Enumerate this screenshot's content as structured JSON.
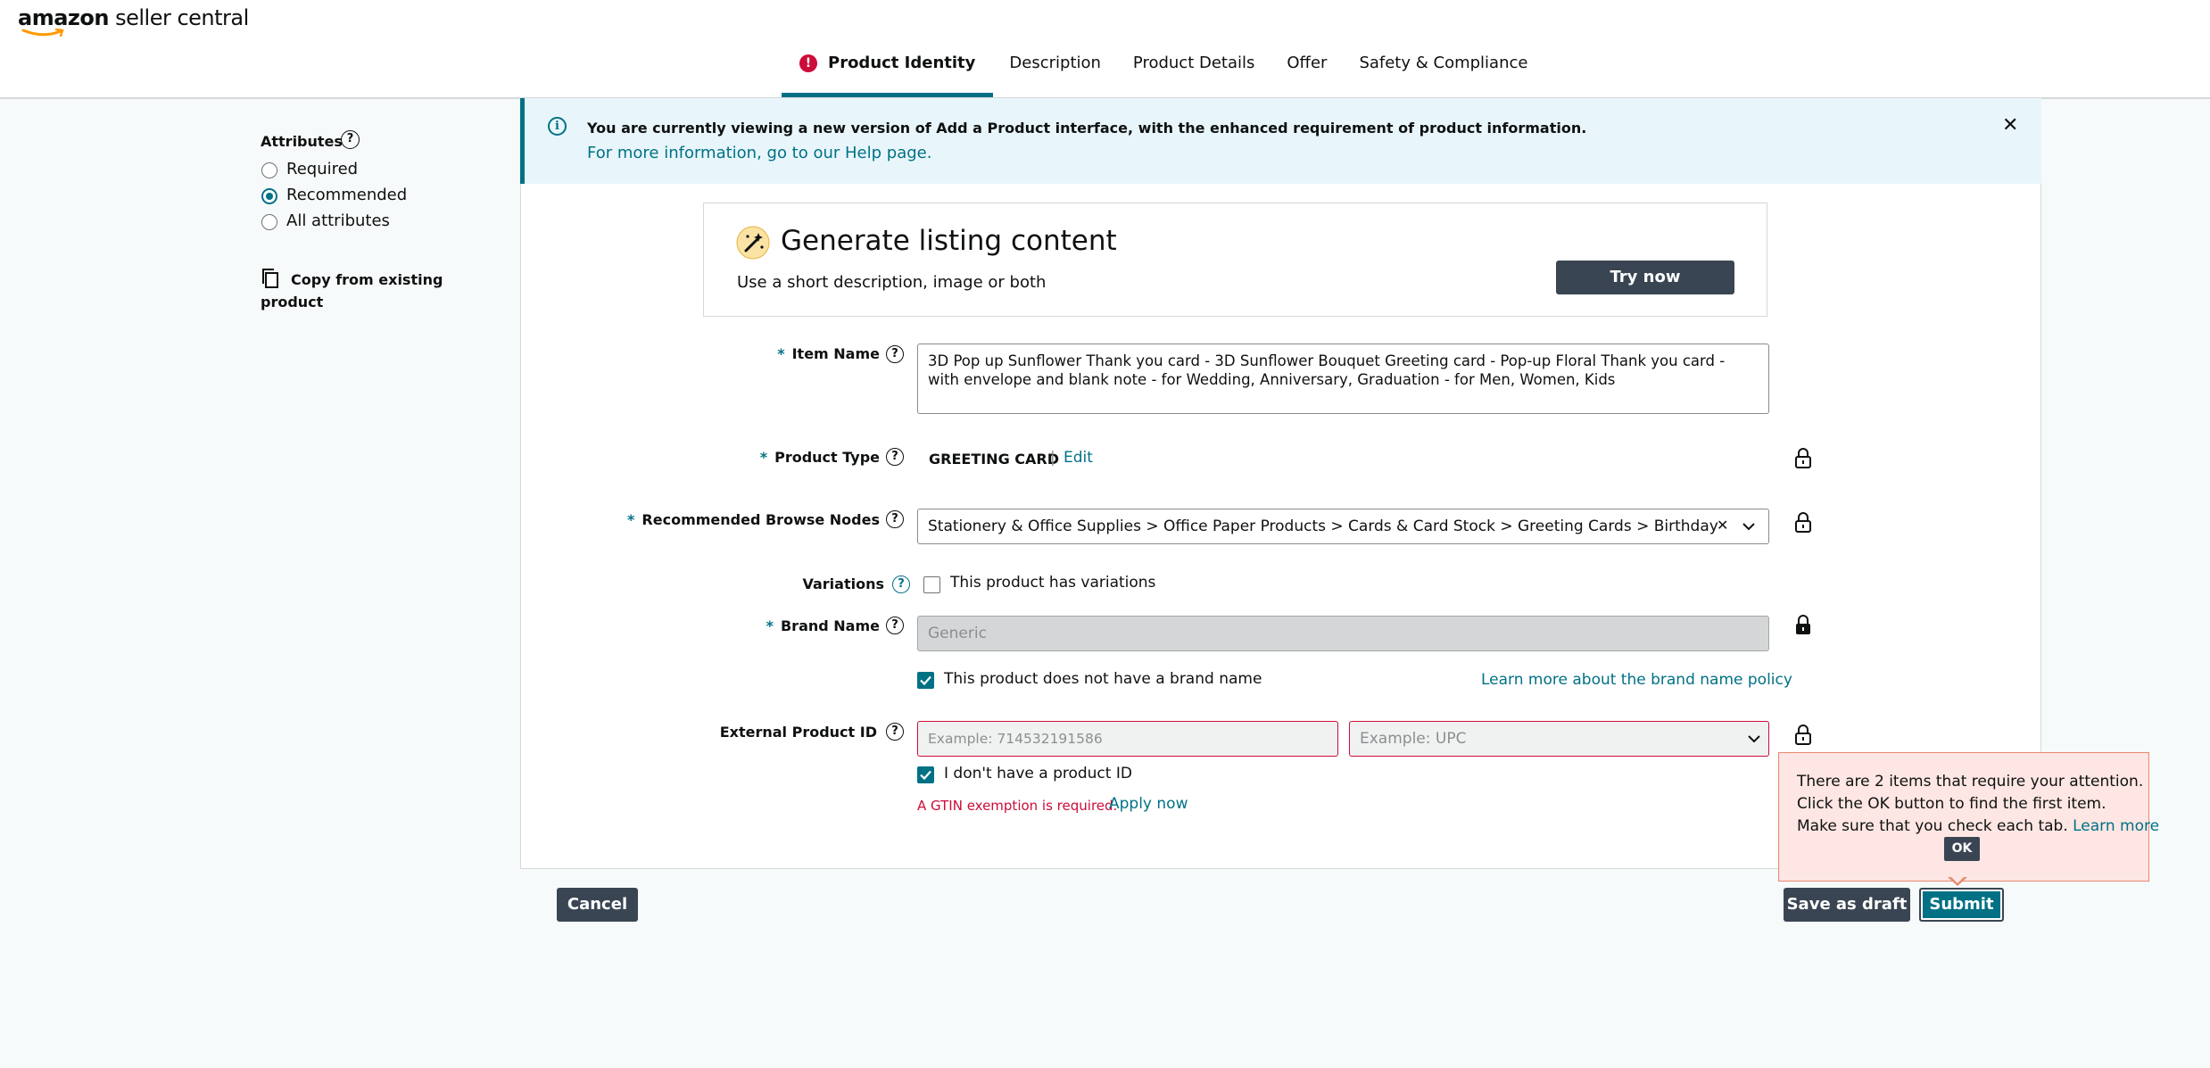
{
  "header": {
    "logo_brand": "amazon",
    "logo_suffix": "seller central",
    "tabs": [
      {
        "label": "Product Identity",
        "has_error": true,
        "active": true
      },
      {
        "label": "Description"
      },
      {
        "label": "Product Details"
      },
      {
        "label": "Offer"
      },
      {
        "label": "Safety & Compliance"
      }
    ],
    "error_glyph": "!"
  },
  "sidebar": {
    "attributes_title": "Attributes",
    "help_glyph": "?",
    "options": [
      {
        "label": "Required",
        "selected": false
      },
      {
        "label": "Recommended",
        "selected": true
      },
      {
        "label": "All attributes",
        "selected": false
      }
    ],
    "copy_label_line1": "Copy from existing",
    "copy_label_line2": "product"
  },
  "banner": {
    "message": "You are currently viewing a new version of Add a Product interface, with the enhanced requirement of product information.",
    "link": "For more information, go to our Help page.",
    "info_glyph": "i",
    "close_glyph": "✕"
  },
  "generate": {
    "title": "Generate listing content",
    "subtitle": "Use a short description, image or both",
    "button": "Try now",
    "icon": "magic-wand-icon"
  },
  "form": {
    "item_name": {
      "label": "Item Name",
      "value": "3D Pop up Sunflower Thank you card - 3D Sunflower Bouquet Greeting card - Pop-up Floral Thank you card - with envelope and blank note - for Wedding, Anniversary, Graduation - for Men, Women, Kids"
    },
    "product_type": {
      "label": "Product Type",
      "value": "GREETING CARD",
      "separator": "|",
      "edit": "Edit"
    },
    "browse_nodes": {
      "label": "Recommended Browse Nodes",
      "value": "Stationery & Office Supplies > Office Paper Products > Cards & Card Stock > Greeting Cards > Birthday",
      "clear_glyph": "✕"
    },
    "variations": {
      "label": "Variations",
      "checkbox_label": "This product has variations",
      "checked": false
    },
    "brand_name": {
      "label": "Brand Name",
      "placeholder": "Generic",
      "no_brand_label": "This product does not have a brand name",
      "no_brand_checked": true,
      "policy_link": "Learn more about the brand name policy"
    },
    "external_id": {
      "label": "External Product ID",
      "id_placeholder": "Example: 714532191586",
      "type_placeholder": "Example: UPC",
      "no_id_label": "I don't have a product ID",
      "no_id_checked": true,
      "error_text": "A GTIN exemption is required.",
      "apply_link": "Apply now"
    },
    "required_marker": "*"
  },
  "popup": {
    "line1": "There are 2 items that require your attention.",
    "line2": "Click the OK button to find the first item.",
    "line3": "Make sure that you check each tab.",
    "learn_more": "Learn more",
    "ok": "OK"
  },
  "footer": {
    "cancel": "Cancel",
    "save_draft": "Save as draft",
    "submit": "Submit"
  },
  "colors": {
    "accent": "#007185",
    "error": "#cc0c39",
    "dark_button": "#3a4553",
    "banner_bg": "#e8f6fb",
    "popup_bg": "#fde6e3"
  }
}
